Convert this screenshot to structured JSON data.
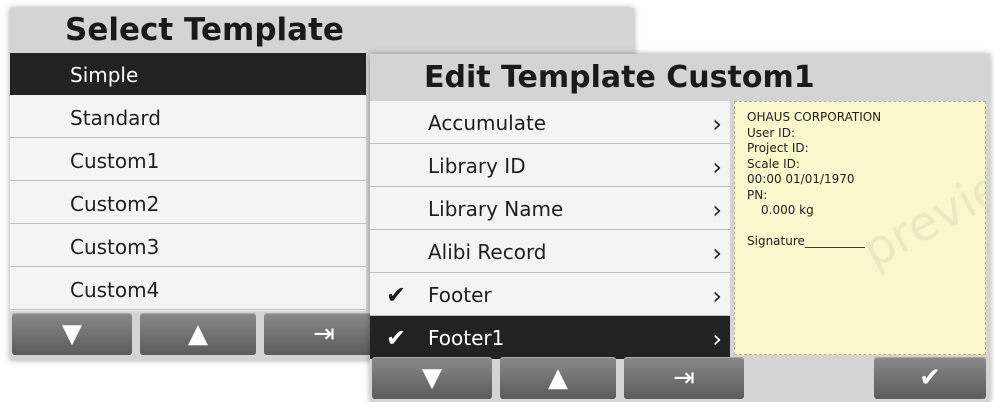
{
  "select_template": {
    "title": "Select Template",
    "items": [
      "Simple",
      "Standard",
      "Custom1",
      "Custom2",
      "Custom3",
      "Custom4"
    ]
  },
  "edit_template": {
    "title": "Edit Template Custom1",
    "items": [
      {
        "label": "Accumulate",
        "checked": false
      },
      {
        "label": "Library ID",
        "checked": false
      },
      {
        "label": "Library Name",
        "checked": false
      },
      {
        "label": "Alibi Record",
        "checked": false
      },
      {
        "label": "Footer",
        "checked": true
      },
      {
        "label": "Footer1",
        "checked": true
      }
    ]
  },
  "preview": {
    "lines": [
      "OHAUS CORPORATION",
      "User ID:",
      "Project ID:",
      "Scale ID:",
      "00:00 01/01/1970",
      "PN:",
      "0.000 kg",
      "",
      "Signature__________"
    ],
    "watermark": "preview"
  },
  "icons": {
    "down": "▼",
    "up": "▲",
    "exit": "⇥",
    "chevron": "›",
    "check": "✔"
  }
}
